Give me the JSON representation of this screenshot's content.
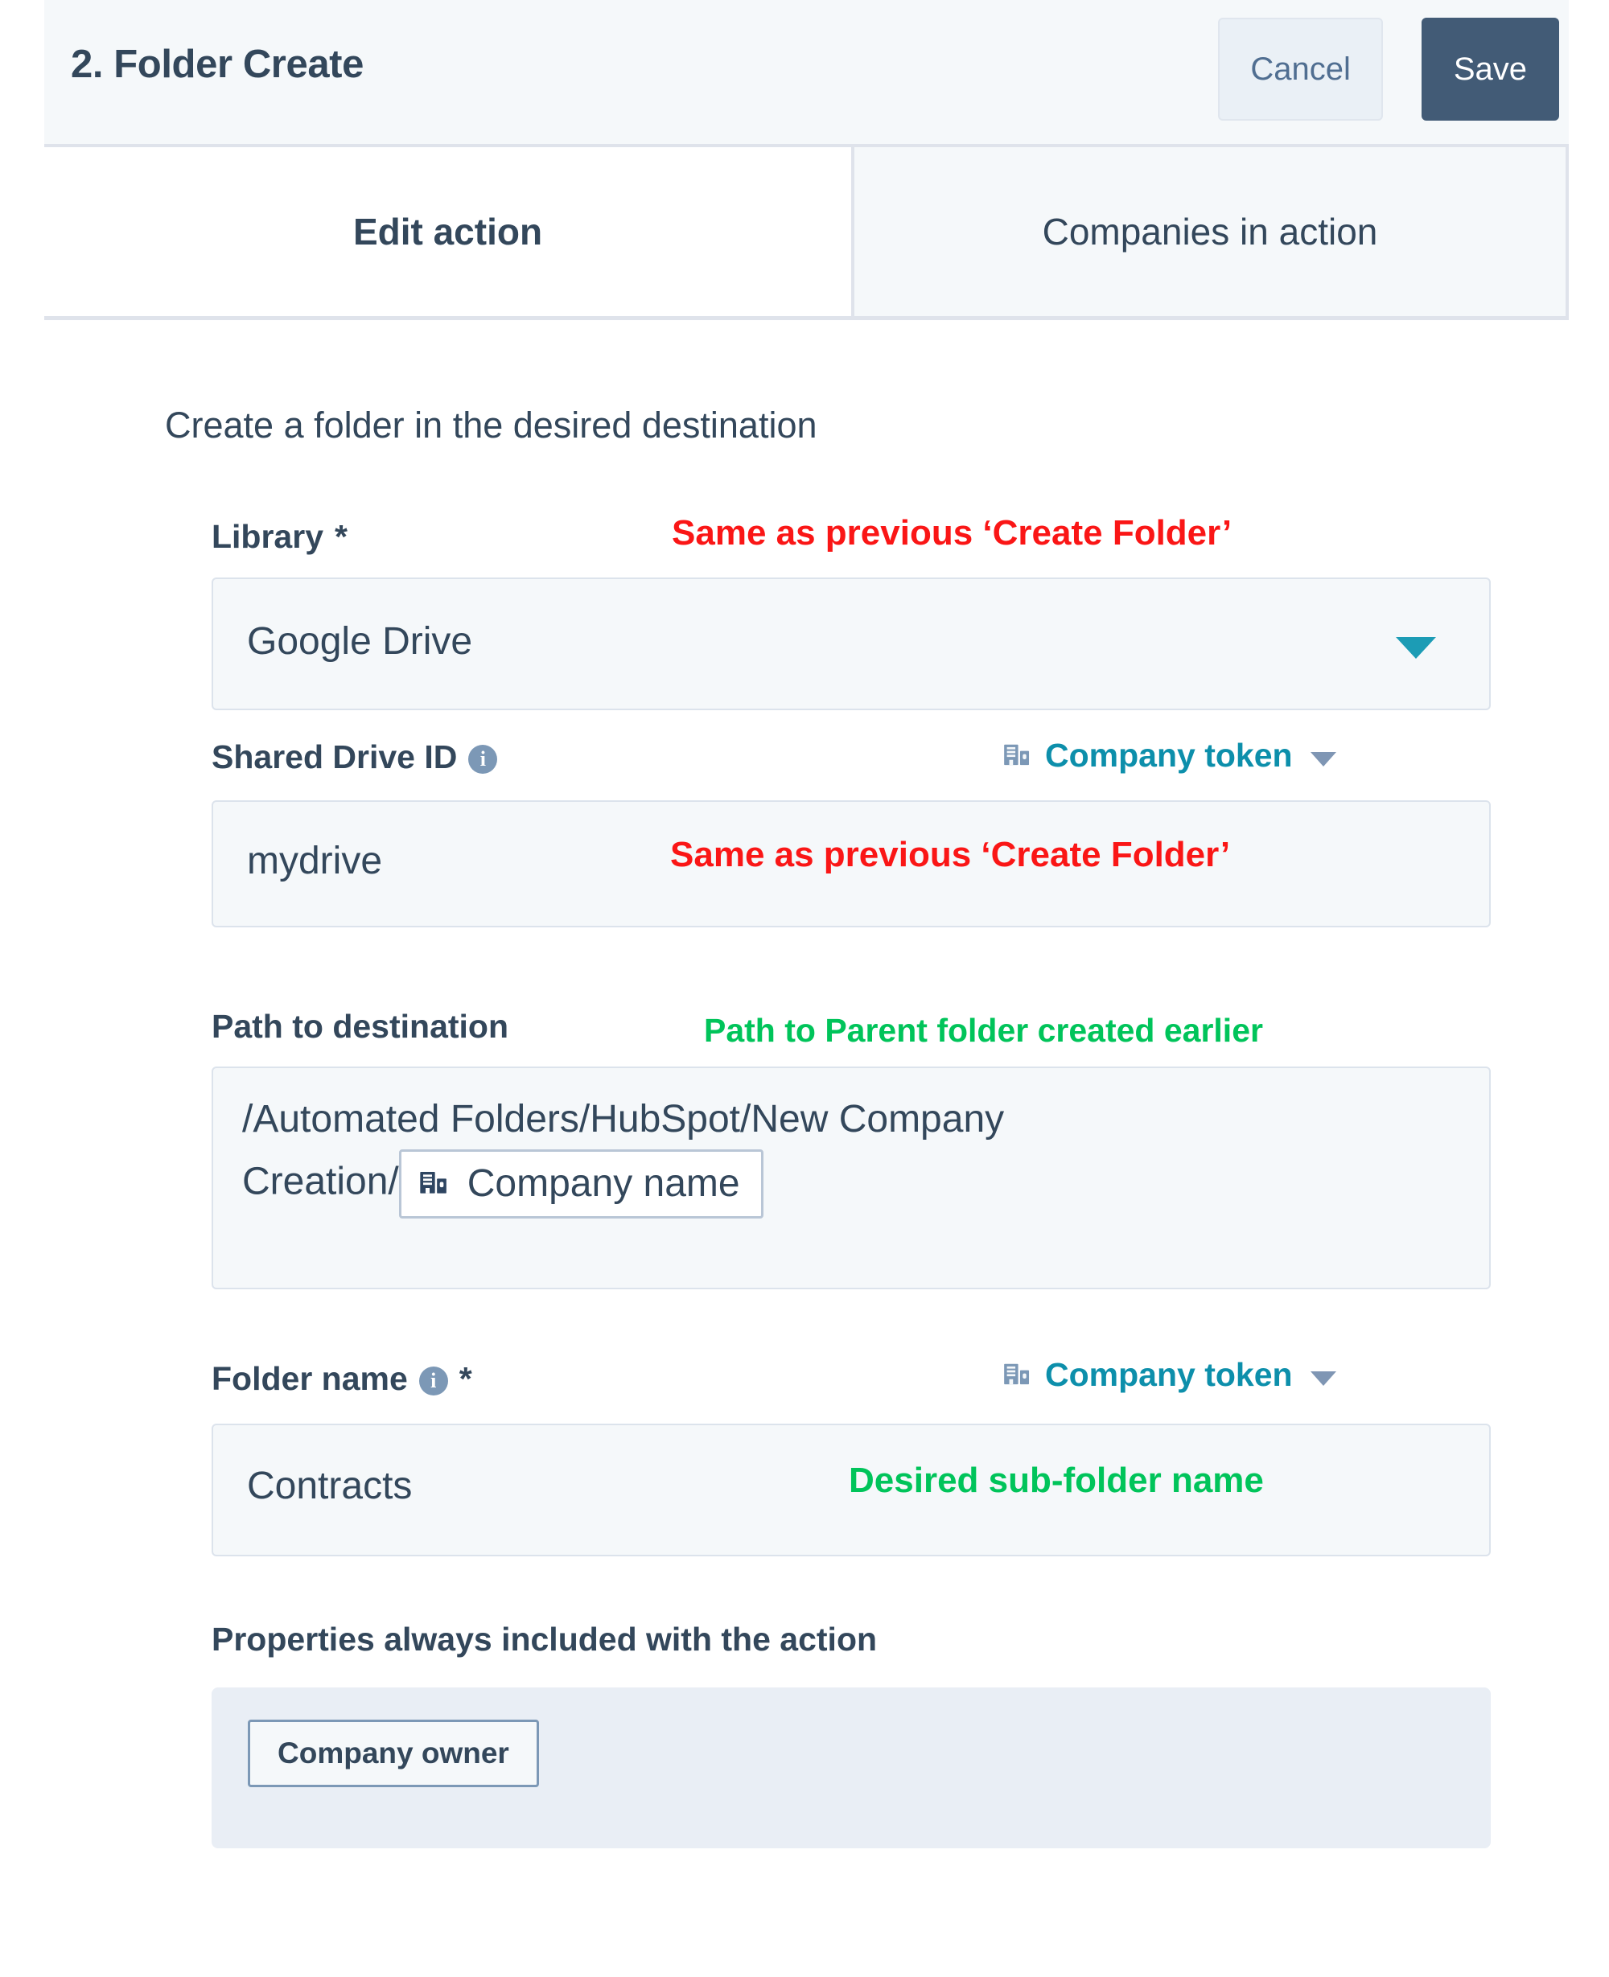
{
  "header": {
    "title": "2. Folder Create",
    "cancel_label": "Cancel",
    "save_label": "Save"
  },
  "tabs": [
    {
      "label": "Edit action",
      "active": true
    },
    {
      "label": "Companies in action",
      "active": false
    }
  ],
  "body": {
    "description": "Create a folder in the desired destination",
    "fields": {
      "library": {
        "label": "Library",
        "required_marker": "*",
        "value": "Google Drive"
      },
      "shared_drive_id": {
        "label": "Shared Drive ID",
        "info_glyph": "i",
        "token_link": "Company token",
        "value": "mydrive"
      },
      "path_to_destination": {
        "label": "Path to destination",
        "value_line1": "/Automated Folders/HubSpot/New Company",
        "value_line2": "Creation/",
        "token_chip": "Company name"
      },
      "folder_name": {
        "label": "Folder name",
        "info_glyph": "i",
        "required_marker": "*",
        "token_link": "Company token",
        "value": "Contracts"
      },
      "properties": {
        "label": "Properties always included with the action",
        "chips": [
          "Company owner"
        ]
      }
    },
    "annotations": [
      {
        "text": "Same as previous ‘Create Folder’",
        "color": "red"
      },
      {
        "text": "Same as previous ‘Create Folder’",
        "color": "red"
      },
      {
        "text": "Path to Parent folder created earlier",
        "color": "green"
      },
      {
        "text": "Desired sub-folder name",
        "color": "green"
      }
    ]
  },
  "colors": {
    "save_button": "#425b76",
    "token_link": "#0d8fab",
    "annotation_red": "#fa1616",
    "annotation_green": "#00c45a",
    "text": "#33475b"
  }
}
